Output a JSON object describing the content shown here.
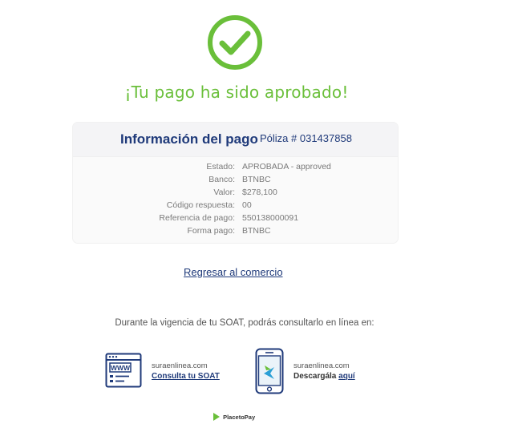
{
  "colors": {
    "success": "#6abf3a",
    "primary": "#1f3a7a",
    "muted": "#7a7a7a"
  },
  "status": {
    "icon": "check-circle-icon",
    "headline": "¡Tu pago ha sido aprobado!"
  },
  "payment_info": {
    "title": "Información del pago",
    "policy": "Póliza # 031437858",
    "rows": [
      {
        "label": "Estado:",
        "value": "APROBADA - approved"
      },
      {
        "label": "Banco:",
        "value": "BTNBC"
      },
      {
        "label": "Valor:",
        "value": "$278,100"
      },
      {
        "label": "Código respuesta:",
        "value": "00"
      },
      {
        "label": "Referencia de pago:",
        "value": "550138000091"
      },
      {
        "label": "Forma pago:",
        "value": "BTNBC"
      }
    ]
  },
  "return_link": "Regresar al comercio",
  "info_text": "Durante la vigencia de tu SOAT, podrás consultarlo en línea en:",
  "online": {
    "site": {
      "icon": "www-browser-icon",
      "name": "suraenlinea.com",
      "link": "Consulta tu SOAT"
    },
    "app": {
      "icon": "mobile-app-icon",
      "name": "suraenlinea.com",
      "prefix": "Descargála",
      "link": "aquí"
    }
  },
  "provider": {
    "name": "PlacetoPay",
    "icon": "placetopay-logo-icon"
  }
}
